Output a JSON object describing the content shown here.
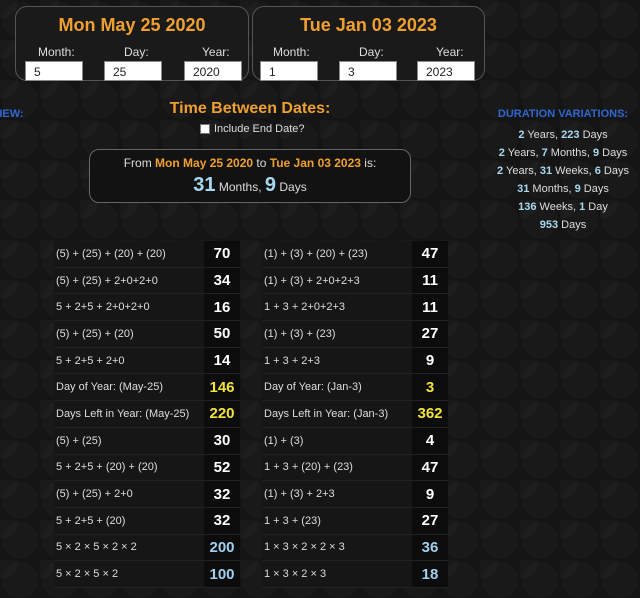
{
  "date1": {
    "title": "Mon May 25 2020",
    "month_label": "Month:",
    "day_label": "Day:",
    "year_label": "Year:",
    "month": "5",
    "day": "25",
    "year": "2020"
  },
  "date2": {
    "title": "Tue Jan 03 2023",
    "month_label": "Month:",
    "day_label": "Day:",
    "year_label": "Year:",
    "month": "1",
    "day": "3",
    "year": "2023"
  },
  "left_label": "VIEW:",
  "between": {
    "title": "Time Between Dates:",
    "include_end_label": "Include End Date?",
    "from_prefix": "From",
    "from_date": "Mon May 25 2020",
    "to_word": "to",
    "to_date": "Tue Jan 03 2023",
    "suffix": "is:",
    "months": "31",
    "months_label": "Months,",
    "days": "9",
    "days_label": "Days"
  },
  "duration": {
    "title": "DURATION VARIATIONS:",
    "lines": [
      {
        "parts": [
          "2",
          " Years, ",
          "223",
          " Days"
        ]
      },
      {
        "parts": [
          "2",
          " Years, ",
          "7",
          " Months, ",
          "9",
          " Days"
        ]
      },
      {
        "parts": [
          "2",
          " Years, ",
          "31",
          " Weeks, ",
          "6",
          " Days"
        ]
      },
      {
        "parts": [
          "31",
          " Months, ",
          "9",
          " Days"
        ]
      },
      {
        "parts": [
          "136",
          " Weeks, ",
          "1",
          " Day"
        ]
      },
      {
        "parts": [
          "953",
          " Days"
        ]
      }
    ]
  },
  "table1": [
    {
      "expr": "(5) + (25) + (20) + (20)",
      "val": "70",
      "color": "white"
    },
    {
      "expr": "(5) + (25) + 2+0+2+0",
      "val": "34",
      "color": "white"
    },
    {
      "expr": "5 + 2+5 + 2+0+2+0",
      "val": "16",
      "color": "white"
    },
    {
      "expr": "(5) + (25) + (20)",
      "val": "50",
      "color": "white"
    },
    {
      "expr": "5 + 2+5 + 2+0",
      "val": "14",
      "color": "white"
    },
    {
      "expr": "Day of Year: (May-25)",
      "val": "146",
      "color": "yellow"
    },
    {
      "expr": "Days Left in Year: (May-25)",
      "val": "220",
      "color": "yellow"
    },
    {
      "expr": "(5) + (25)",
      "val": "30",
      "color": "white"
    },
    {
      "expr": "5 + 2+5 + (20) + (20)",
      "val": "52",
      "color": "white"
    },
    {
      "expr": "(5) + (25) + 2+0",
      "val": "32",
      "color": "white"
    },
    {
      "expr": "5 + 2+5 + (20)",
      "val": "32",
      "color": "white"
    },
    {
      "expr": "5 × 2 × 5 × 2 × 2",
      "val": "200",
      "color": "blue"
    },
    {
      "expr": "5 × 2 × 5 × 2",
      "val": "100",
      "color": "blue"
    }
  ],
  "table2": [
    {
      "expr": "(1) + (3) + (20) + (23)",
      "val": "47",
      "color": "white"
    },
    {
      "expr": "(1) + (3) + 2+0+2+3",
      "val": "11",
      "color": "white"
    },
    {
      "expr": "1 + 3 + 2+0+2+3",
      "val": "11",
      "color": "white"
    },
    {
      "expr": "(1) + (3) + (23)",
      "val": "27",
      "color": "white"
    },
    {
      "expr": "1 + 3 + 2+3",
      "val": "9",
      "color": "white"
    },
    {
      "expr": "Day of Year: (Jan-3)",
      "val": "3",
      "color": "yellow"
    },
    {
      "expr": "Days Left in Year: (Jan-3)",
      "val": "362",
      "color": "yellow"
    },
    {
      "expr": "(1) + (3)",
      "val": "4",
      "color": "white"
    },
    {
      "expr": "1 + 3 + (20) + (23)",
      "val": "47",
      "color": "white"
    },
    {
      "expr": "(1) + (3) + 2+3",
      "val": "9",
      "color": "white"
    },
    {
      "expr": "1 + 3 + (23)",
      "val": "27",
      "color": "white"
    },
    {
      "expr": "1 × 3 × 2 × 2 × 3",
      "val": "36",
      "color": "blue"
    },
    {
      "expr": "1 × 3 × 2 × 3",
      "val": "18",
      "color": "blue"
    }
  ]
}
